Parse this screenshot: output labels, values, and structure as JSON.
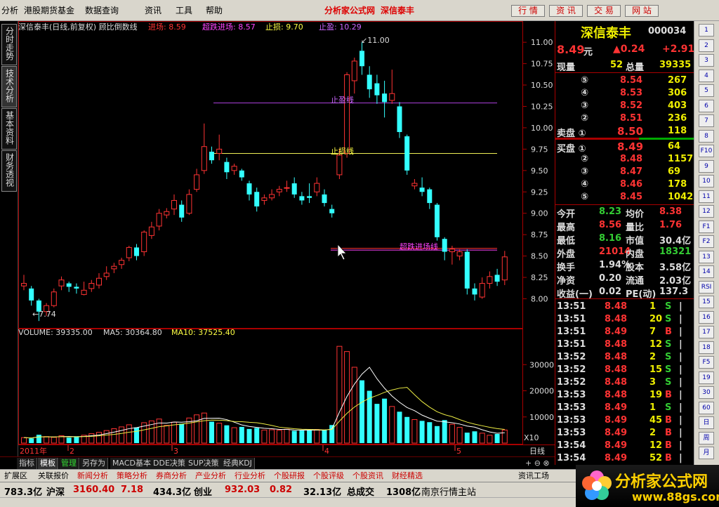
{
  "menu": {
    "items": [
      "分析",
      "港股期货基金",
      "数据查询",
      "资讯",
      "工具",
      "帮助"
    ],
    "brand": "分析家公式网",
    "stock_name": "深信泰丰",
    "right_buttons": [
      "行 情",
      "资 讯",
      "交 易",
      "网 站"
    ]
  },
  "left_tabs": [
    "分时走势",
    "技术分析",
    "基本资料",
    "财务透视"
  ],
  "indicator": {
    "title": "深信泰丰(日线,前复权) 顾比倒数线",
    "items": [
      {
        "label": "进场: 8.59",
        "color": "#ff3333"
      },
      {
        "label": "超跌进场: 8.57",
        "color": "#ff44ff"
      },
      {
        "label": "止损: 9.70",
        "color": "#ffff44"
      },
      {
        "label": "止盈: 10.29",
        "color": "#cc66ff"
      }
    ],
    "line_labels": {
      "stop_profit": "止盈线",
      "stop_loss": "止损线",
      "oversold": "超跌进场线"
    },
    "high_label": "11.00",
    "low_label": "7.74"
  },
  "price_axis": [
    "11.00",
    "10.75",
    "10.50",
    "10.25",
    "10.00",
    "9.75",
    "9.50",
    "9.25",
    "9.00",
    "8.75",
    "8.50",
    "8.25",
    "8.00"
  ],
  "volume": {
    "vol_label": "VOLUME: 39335.00",
    "ma5_label": "MA5: 30364.80",
    "ma10_label": "MA10: 37525.40",
    "axis": [
      "30000",
      "20000",
      "10000"
    ],
    "unit": "X10"
  },
  "date_axis": {
    "labels": [
      "2011年",
      "2",
      "3",
      "4",
      "5"
    ],
    "period": "日线"
  },
  "chart_data": {
    "type": "candlestick",
    "price_ylim": [
      7.7,
      11.1
    ],
    "volume_ylim": [
      0,
      40000
    ],
    "lines": {
      "stop_profit": 10.29,
      "stop_loss": 9.7,
      "oversold_entry": 8.57,
      "entry": 8.59
    },
    "candles": [
      [
        8.15,
        8.18,
        8.28,
        8.1,
        "u"
      ],
      [
        8.12,
        7.98,
        8.15,
        7.92,
        "d"
      ],
      [
        7.98,
        7.85,
        8.0,
        7.74,
        "d"
      ],
      [
        7.85,
        7.92,
        7.95,
        7.8,
        "u"
      ],
      [
        7.92,
        8.08,
        8.12,
        7.9,
        "u"
      ],
      [
        8.15,
        8.22,
        8.26,
        8.1,
        "u"
      ],
      [
        8.18,
        8.14,
        8.2,
        8.08,
        "d"
      ],
      [
        8.14,
        8.12,
        8.18,
        8.06,
        "d"
      ],
      [
        8.05,
        8.1,
        8.2,
        8.04,
        "u"
      ],
      [
        8.12,
        8.18,
        8.22,
        8.08,
        "u"
      ],
      [
        8.16,
        8.24,
        8.3,
        8.12,
        "u"
      ],
      [
        8.26,
        8.3,
        8.38,
        8.22,
        "u"
      ],
      [
        8.35,
        8.38,
        8.42,
        8.3,
        "u"
      ],
      [
        8.4,
        8.45,
        8.48,
        8.35,
        "u"
      ],
      [
        8.48,
        8.6,
        8.62,
        8.44,
        "u"
      ],
      [
        8.6,
        8.5,
        8.64,
        8.45,
        "d"
      ],
      [
        8.55,
        8.78,
        8.8,
        8.5,
        "u"
      ],
      [
        8.74,
        8.84,
        8.9,
        8.7,
        "u"
      ],
      [
        8.85,
        9.0,
        9.05,
        8.8,
        "u"
      ],
      [
        8.98,
        9.02,
        9.06,
        8.94,
        "u"
      ],
      [
        9.05,
        9.15,
        9.22,
        8.98,
        "u"
      ],
      [
        9.1,
        8.95,
        9.15,
        8.9,
        "d"
      ],
      [
        9.0,
        9.22,
        9.28,
        8.98,
        "u"
      ],
      [
        9.28,
        9.45,
        9.52,
        9.25,
        "u"
      ],
      [
        9.5,
        9.78,
        10.05,
        9.46,
        "u"
      ],
      [
        9.62,
        9.72,
        9.78,
        9.58,
        "d"
      ],
      [
        9.7,
        9.75,
        9.92,
        9.62,
        "u"
      ],
      [
        9.6,
        9.48,
        9.65,
        9.4,
        "d"
      ],
      [
        9.5,
        9.55,
        9.58,
        9.45,
        "u"
      ],
      [
        9.5,
        9.42,
        9.52,
        9.38,
        "d"
      ],
      [
        9.35,
        9.22,
        9.38,
        9.15,
        "d"
      ],
      [
        9.25,
        9.08,
        9.3,
        9.02,
        "d"
      ],
      [
        9.15,
        9.18,
        9.22,
        9.1,
        "u"
      ],
      [
        9.18,
        9.22,
        9.28,
        9.15,
        "u"
      ],
      [
        9.25,
        9.28,
        9.32,
        9.2,
        "u"
      ],
      [
        9.3,
        9.3,
        9.38,
        9.25,
        "u"
      ],
      [
        9.35,
        9.22,
        9.42,
        9.18,
        "d"
      ],
      [
        9.2,
        9.15,
        9.25,
        9.1,
        "d"
      ],
      [
        9.2,
        9.18,
        9.35,
        9.12,
        "d"
      ],
      [
        9.25,
        9.35,
        9.42,
        9.2,
        "u"
      ],
      [
        9.22,
        9.12,
        9.28,
        9.08,
        "d"
      ],
      [
        9.05,
        9.0,
        9.1,
        8.95,
        "d"
      ],
      [
        9.45,
        9.68,
        9.75,
        9.4,
        "u"
      ],
      [
        9.7,
        10.62,
        10.65,
        9.65,
        "u"
      ],
      [
        10.55,
        10.78,
        10.82,
        10.4,
        "u"
      ],
      [
        10.9,
        10.72,
        11.0,
        10.62,
        "d"
      ],
      [
        10.62,
        10.45,
        10.72,
        10.35,
        "d"
      ],
      [
        10.52,
        10.38,
        10.62,
        10.28,
        "d"
      ],
      [
        10.4,
        10.3,
        10.55,
        10.12,
        "d"
      ],
      [
        10.4,
        10.32,
        10.68,
        10.28,
        "u"
      ],
      [
        10.25,
        9.95,
        10.3,
        9.88,
        "d"
      ],
      [
        9.9,
        9.5,
        9.92,
        9.45,
        "d"
      ],
      [
        9.35,
        9.32,
        9.4,
        9.28,
        "u"
      ],
      [
        9.3,
        9.25,
        9.42,
        9.2,
        "d"
      ],
      [
        9.28,
        9.12,
        9.3,
        9.05,
        "d"
      ],
      [
        9.1,
        8.72,
        9.12,
        8.68,
        "d"
      ],
      [
        8.7,
        8.55,
        8.72,
        8.45,
        "d"
      ],
      [
        8.55,
        8.58,
        8.62,
        8.4,
        "u"
      ],
      [
        8.5,
        8.55,
        8.58,
        8.45,
        "u"
      ],
      [
        8.55,
        8.12,
        8.58,
        8.05,
        "d"
      ],
      [
        8.12,
        8.05,
        8.18,
        7.98,
        "d"
      ],
      [
        8.02,
        8.18,
        8.25,
        8.0,
        "u"
      ],
      [
        8.18,
        8.26,
        8.32,
        8.12,
        "u"
      ],
      [
        8.28,
        8.2,
        8.35,
        8.15,
        "d"
      ],
      [
        8.22,
        8.49,
        8.56,
        8.16,
        "u"
      ]
    ],
    "volumes": [
      2100,
      1800,
      3200,
      2500,
      2200,
      2800,
      2100,
      2600,
      3000,
      3600,
      4100,
      4800,
      5500,
      6200,
      7000,
      6000,
      7800,
      8500,
      9200,
      6800,
      8000,
      7400,
      9600,
      10800,
      11500,
      8200,
      7600,
      6800,
      5900,
      6200,
      5400,
      5800,
      5000,
      5100,
      4900,
      5300,
      4700,
      4800,
      5000,
      5200,
      5000,
      6900,
      37000,
      35000,
      29000,
      24000,
      20000,
      15000,
      17000,
      14000,
      12000,
      10000,
      9000,
      8500,
      8000,
      6500,
      8800,
      7200,
      6000,
      4000,
      4500,
      3800,
      3000,
      3500,
      5000
    ],
    "volume_colors": [
      "u",
      "d",
      "d",
      "u",
      "u",
      "u",
      "d",
      "d",
      "u",
      "u",
      "u",
      "u",
      "u",
      "u",
      "u",
      "d",
      "u",
      "u",
      "u",
      "u",
      "u",
      "d",
      "u",
      "u",
      "u",
      "d",
      "u",
      "d",
      "u",
      "d",
      "d",
      "d",
      "u",
      "u",
      "u",
      "u",
      "d",
      "d",
      "d",
      "u",
      "d",
      "d",
      "u",
      "u",
      "u",
      "d",
      "d",
      "d",
      "d",
      "u",
      "d",
      "d",
      "u",
      "d",
      "d",
      "d",
      "d",
      "u",
      "u",
      "d",
      "d",
      "u",
      "u",
      "d",
      "u"
    ]
  },
  "quote": {
    "name": "深信泰丰",
    "code": "000034",
    "price": "8.49",
    "unit": "元",
    "change": "▲0.24",
    "pct": "+2.91",
    "now_vol_label": "现量",
    "now_vol": "52",
    "total_vol_label": "总量",
    "total_vol": "39335",
    "sell": [
      {
        "lv": "⑤",
        "p": "8.54",
        "v": "267"
      },
      {
        "lv": "④",
        "p": "8.53",
        "v": "306"
      },
      {
        "lv": "③",
        "p": "8.52",
        "v": "403"
      },
      {
        "lv": "②",
        "p": "8.51",
        "v": "236"
      },
      {
        "lv": "卖盘 ①",
        "p": "8.50",
        "v": "118"
      }
    ],
    "buy": [
      {
        "lv": "买盘 ①",
        "p": "8.49",
        "v": "64"
      },
      {
        "lv": "②",
        "p": "8.48",
        "v": "1157"
      },
      {
        "lv": "③",
        "p": "8.47",
        "v": "69"
      },
      {
        "lv": "④",
        "p": "8.46",
        "v": "178"
      },
      {
        "lv": "⑤",
        "p": "8.45",
        "v": "1042"
      }
    ],
    "stats": [
      [
        "今开",
        "8.23",
        "g",
        "均价",
        "8.38",
        "r"
      ],
      [
        "最高",
        "8.56",
        "r",
        "量比",
        "1.76",
        "r"
      ],
      [
        "最低",
        "8.16",
        "g",
        "市值",
        "30.4亿",
        "w"
      ],
      [
        "外盘",
        "21014",
        "r",
        "内盘",
        "18321",
        "g"
      ],
      [
        "换手",
        "1.94%",
        "w",
        "股本",
        "3.58亿",
        "w"
      ],
      [
        "净资",
        "0.20",
        "w",
        "流通",
        "2.03亿",
        "w"
      ],
      [
        "收益(一)",
        "0.02",
        "w",
        "PE(动)",
        "137.3",
        "w"
      ]
    ],
    "ticks": [
      [
        "13:51",
        "8.48",
        "1",
        "S"
      ],
      [
        "13:51",
        "8.48",
        "20",
        "S"
      ],
      [
        "13:51",
        "8.49",
        "7",
        "B"
      ],
      [
        "13:51",
        "8.48",
        "12",
        "S"
      ],
      [
        "13:52",
        "8.48",
        "2",
        "S"
      ],
      [
        "13:52",
        "8.48",
        "15",
        "S"
      ],
      [
        "13:52",
        "8.48",
        "3",
        "S"
      ],
      [
        "13:53",
        "8.48",
        "19",
        "B"
      ],
      [
        "13:53",
        "8.49",
        "1",
        "S"
      ],
      [
        "13:53",
        "8.49",
        "45",
        "B"
      ],
      [
        "13:53",
        "8.49",
        "2",
        "B"
      ],
      [
        "13:54",
        "8.49",
        "12",
        "B"
      ],
      [
        "13:54",
        "8.49",
        "52",
        "B"
      ]
    ]
  },
  "tool_icons": [
    "1",
    "2",
    "3",
    "4",
    "5",
    "6",
    "7",
    "8",
    "F10",
    "9",
    "10",
    "11",
    "12",
    "F1",
    "F2",
    "13",
    "14",
    "RSI",
    "15",
    "16",
    "17",
    "18",
    "F5",
    "19",
    "30",
    "60",
    "日",
    "周",
    "月"
  ],
  "tabs": [
    "指标",
    "模板",
    "管理",
    "另存为",
    "MACD基本",
    "DDE决策",
    "SUP决策",
    "经典KDJ"
  ],
  "categories": [
    "扩展区",
    "关联报价",
    "新闻分析",
    "策略分析",
    "券商分析",
    "产业分析",
    "行业分析",
    "个股研报",
    "个股评级",
    "个股资讯",
    "财经精选"
  ],
  "side_bottom": "资讯工场",
  "status": {
    "v1": "783.3亿",
    "l2": "沪深",
    "v2": "3160.40",
    "v3": "7.18",
    "v4": "434.3亿",
    "l5": "创业",
    "v5": "932.03",
    "v6": "0.82",
    "v7": "32.13亿",
    "l8": "总成交",
    "v8": "1308亿",
    "server": "南京行情主站"
  },
  "logo": {
    "text": "分析家公式网",
    "url": "www.88gs.com"
  }
}
